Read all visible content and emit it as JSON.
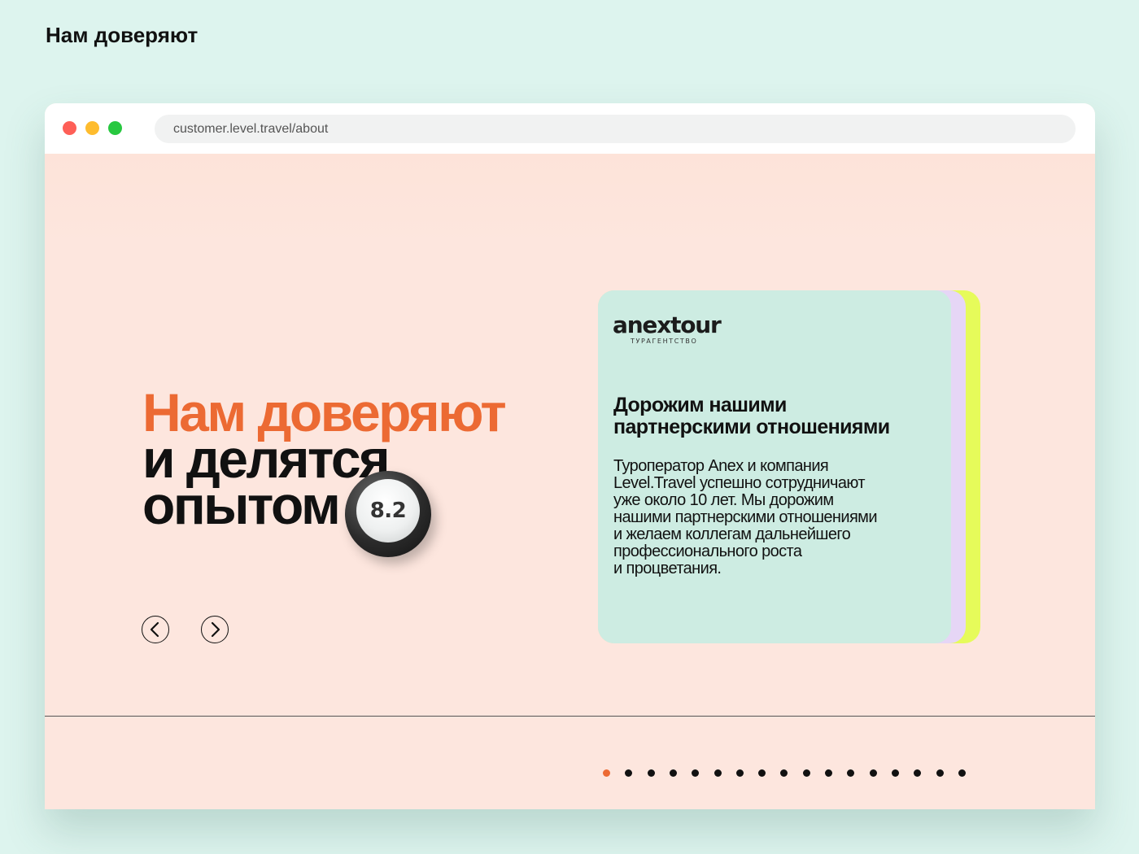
{
  "page": {
    "heading": "Нам доверяют"
  },
  "browser": {
    "url": "customer.level.travel/about"
  },
  "hero": {
    "title_line1": "Нам доверяют",
    "title_line2": "и делятся",
    "title_line3": "опытом",
    "rating": "8.2"
  },
  "nav": {
    "prev_icon": "chevron-left-icon",
    "next_icon": "chevron-right-icon"
  },
  "card": {
    "logo_text": "anextour",
    "logo_sub": "ТУРАГЕНТСТВО",
    "title_line1": "Дорожим нашими",
    "title_line2": "партнерскими отношениями",
    "text_lines": [
      "Туроператор Anex и компания",
      "Level.Travel успешно сотрудничают",
      "уже около 10 лет. Мы дорожим",
      "нашими партнерскими отношениями",
      "и желаем коллегам дальнейшего",
      "профессионального роста",
      "и процветания."
    ]
  },
  "pager": {
    "total": 17,
    "active_index": 0
  },
  "colors": {
    "accent": "#ec6a33",
    "page_bg": "#ddf4ee",
    "site_bg": "#fde6de",
    "card_bg": "#cdece2",
    "card_layer_lilac": "#e6d6f6",
    "card_layer_yellow": "#e6fb5a"
  }
}
